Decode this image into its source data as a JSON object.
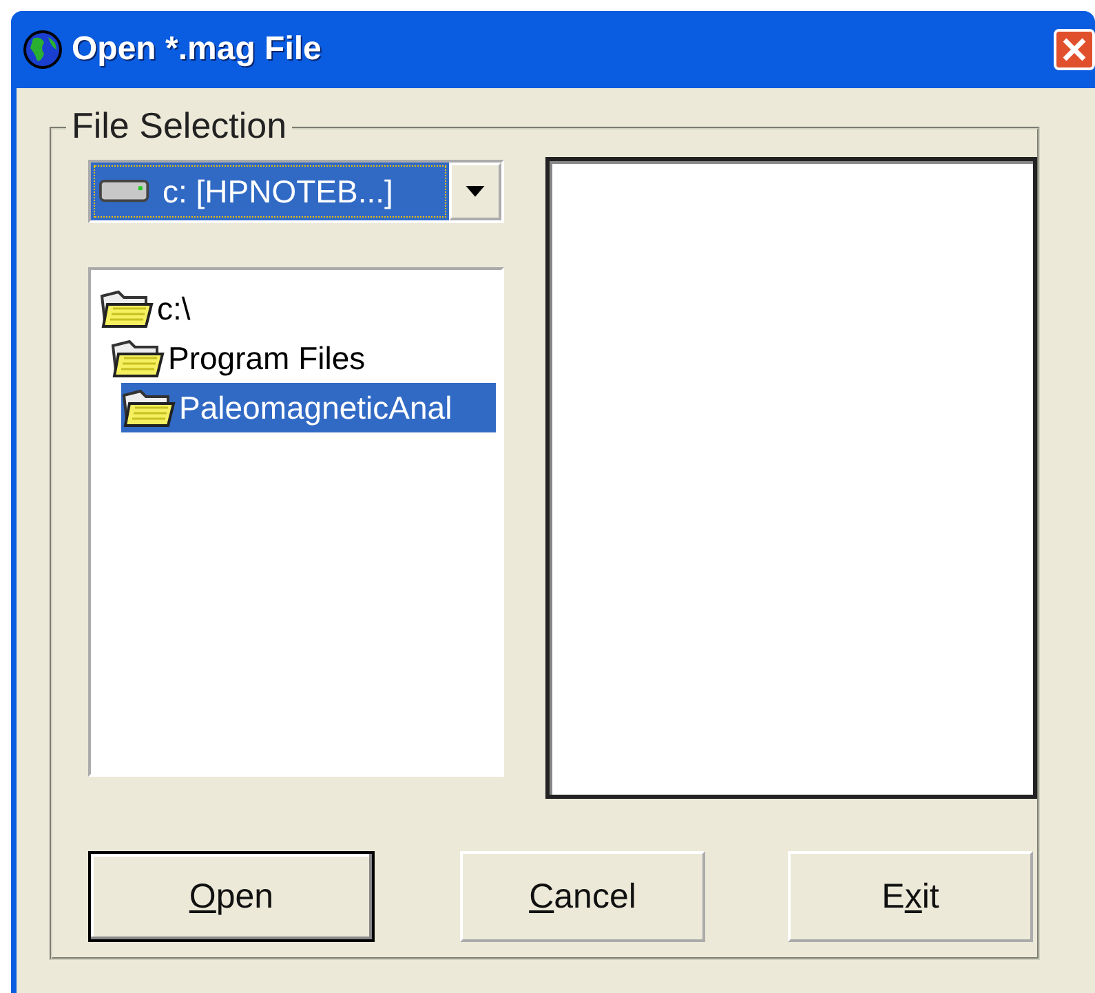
{
  "window": {
    "title": "Open *.mag File"
  },
  "group": {
    "label": "File Selection"
  },
  "drive_combo": {
    "value": "c: [HPNOTEB...]",
    "selected": true
  },
  "folder_tree": [
    {
      "label": "c:\\",
      "selected": false,
      "children": [
        {
          "label": "Program Files",
          "selected": false,
          "children": [
            {
              "label": "PaleomagneticAnal",
              "selected": true
            }
          ]
        }
      ]
    }
  ],
  "buttons": [
    {
      "label_parts": [
        {
          "text": "O",
          "underlined": true
        },
        {
          "text": "pen",
          "underlined": false
        }
      ],
      "default": true
    },
    {
      "label_parts": [
        {
          "text": "C",
          "underlined": true
        },
        {
          "text": "ancel",
          "underlined": false
        }
      ],
      "default": false
    },
    {
      "label_parts": [
        {
          "text": "E",
          "underlined": false
        },
        {
          "text": "x",
          "underlined": true
        },
        {
          "text": "it",
          "underlined": false
        }
      ],
      "default": false
    }
  ]
}
